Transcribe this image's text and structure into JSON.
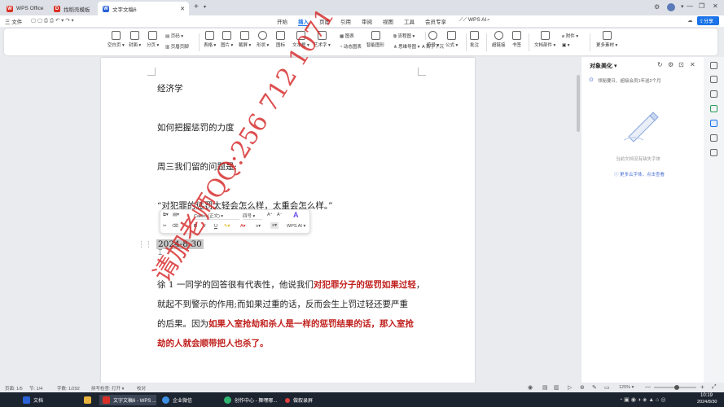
{
  "tabs": [
    {
      "label": "WPS Office",
      "color": "#d93025"
    },
    {
      "label": "找稻壳模板",
      "color": "#d93025"
    },
    {
      "label": "文字文稿6",
      "color": "#2a62d6"
    }
  ],
  "menubar": {
    "file": "三 文件",
    "items": [
      "开始",
      "插入",
      "页面",
      "引用",
      "审阅",
      "视图",
      "工具",
      "会员专享"
    ],
    "active": "插入",
    "wps_ai": "WPS AI",
    "share": "分享"
  },
  "ribbon": [
    {
      "label": "空白页"
    },
    {
      "label": "封面"
    },
    {
      "label": "分页"
    },
    {
      "label": "页眉页脚"
    },
    {
      "label": "表格"
    },
    {
      "label": "图片"
    },
    {
      "label": "截屏"
    },
    {
      "label": "形状"
    },
    {
      "label": "图标"
    },
    {
      "label": "文本框"
    },
    {
      "label": "艺术字"
    },
    {
      "label": "动态图表"
    },
    {
      "label": "智能图形"
    },
    {
      "label": "思维导图"
    },
    {
      "label": "首字下沉"
    },
    {
      "label": "符号"
    },
    {
      "label": "公式"
    },
    {
      "label": "批注"
    },
    {
      "label": "超链接"
    },
    {
      "label": "书签"
    },
    {
      "label": "文档部件"
    },
    {
      "label": "附件"
    },
    {
      "label": "更多素材"
    }
  ],
  "ribbon_sub": {
    "page_num": "页码",
    "chart": "图表",
    "flowchart": "流程图"
  },
  "document": {
    "line1": "经济学",
    "line2": "如何把握惩罚的力度",
    "line3": "周三我们留的问题是:",
    "line4": "“对犯罪的惩罚太轻会怎么样，太重会怎么样。”",
    "date": "2024-8-30",
    "p1_a": "徐 1 一同学的回答很有代表性，他说我们",
    "p1_b": "对犯罪分子的惩罚如果过轻",
    "p1_c": "，",
    "p2": "就起不到警示的作用;而如果过重的话，反而会生上罚过轻还要严重",
    "p3_a": "的后果。因为",
    "p3_b": "如果入室抢劫和杀人是一样的惩罚结果的话，那入室抢",
    "p4": "劫的人就会顺带把人也杀了。"
  },
  "watermark": "请加老师QQ:256 712 1071",
  "float_toolbar": {
    "font": "Calibri (正文)",
    "size": "四号",
    "bold": "B",
    "italic": "I",
    "underline": "U",
    "ai": "WPS AI"
  },
  "panel": {
    "title": "对象美化",
    "notice": "领秘要日、超级会员1年送2个月",
    "empty": "当前文档没有缺失字体",
    "link": "更多云字体，点击查看"
  },
  "status": {
    "page": "页面: 1/5",
    "section": "节: 1/4",
    "words": "字数: 1/292",
    "spell": "拼写检查: 打开",
    "proof": "校对",
    "zoom": "125%"
  },
  "taskbar": {
    "items": [
      "文档",
      "",
      "文字文稿6 - WPS ...",
      "企业微信",
      "创作中心 - 舞嘿哪...",
      "做叙录屏"
    ],
    "time": "10:19",
    "date": "2024/8/30"
  }
}
